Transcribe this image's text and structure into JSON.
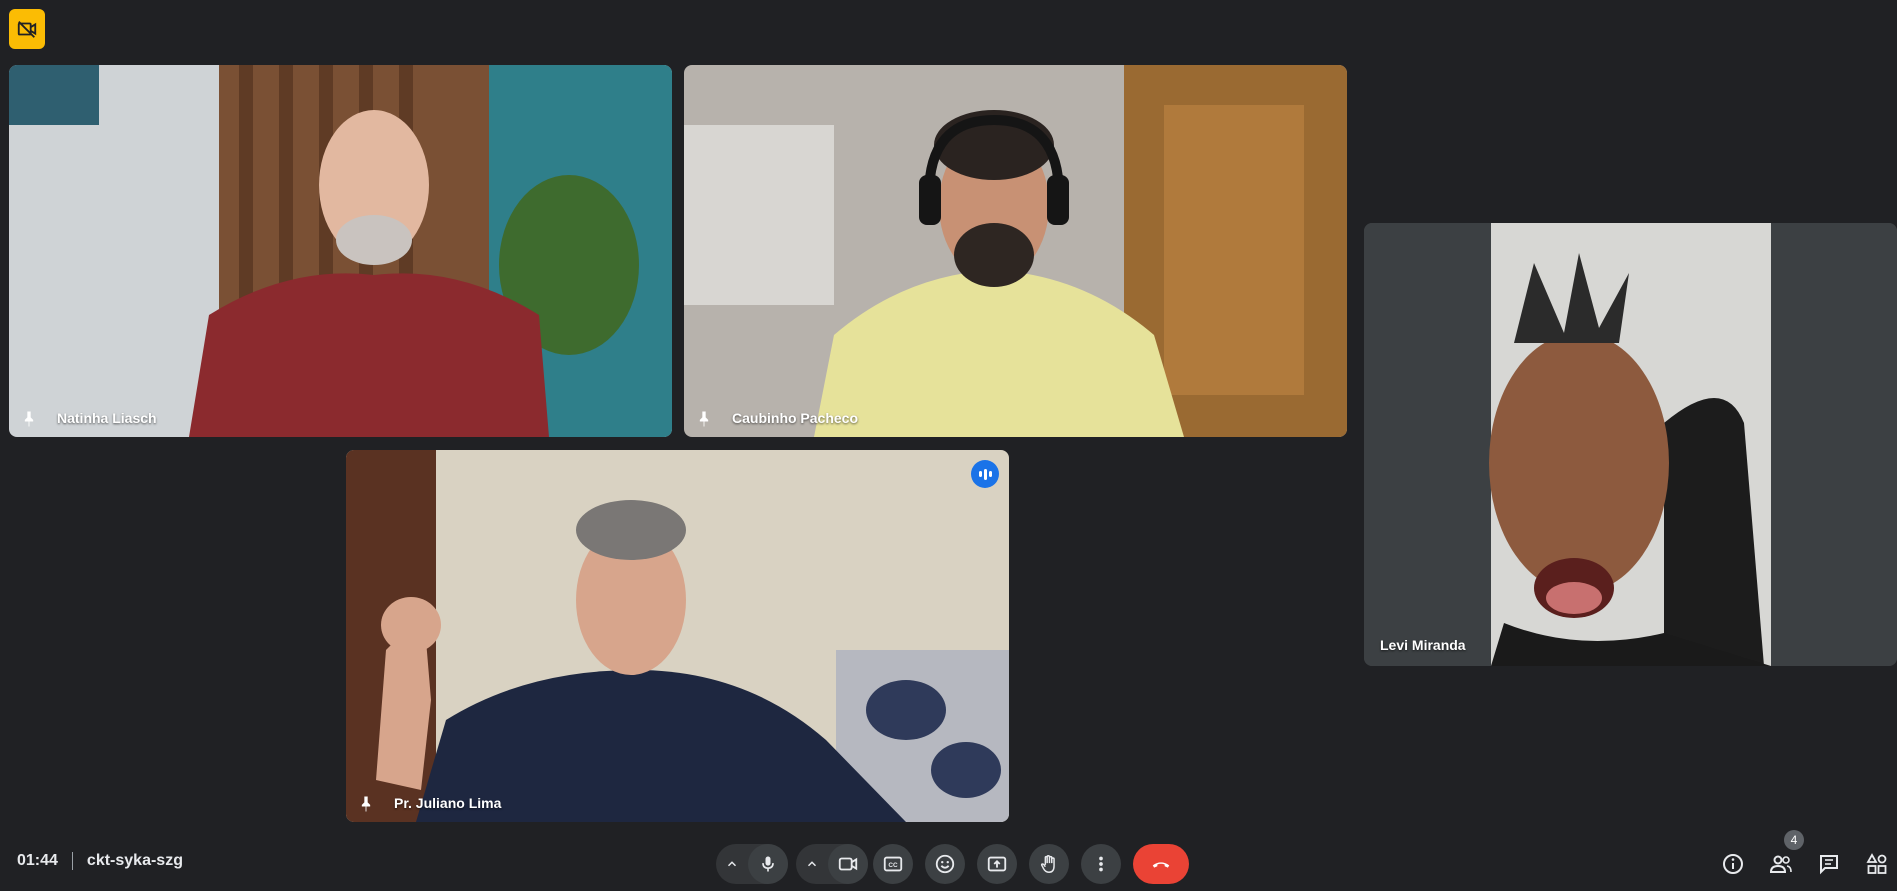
{
  "meeting": {
    "time": "01:44",
    "code": "ckt-syka-szg",
    "participant_count": "4"
  },
  "participants": [
    {
      "name": "Natinha Liasch"
    },
    {
      "name": "Caubinho Pacheco"
    },
    {
      "name": "Levi Miranda"
    },
    {
      "name": "Pr. Juliano Lima"
    }
  ],
  "controls": {
    "mic": "mic-icon",
    "camera": "camera-icon",
    "captions": "captions-icon",
    "reactions": "emoji-icon",
    "present": "present-icon",
    "raise_hand": "hand-icon",
    "more": "more-vert-icon",
    "leave": "end-call-icon"
  },
  "colors": {
    "background": "#202124",
    "control": "#3c4043",
    "leave": "#ea4335",
    "speaking": "#1a73e8",
    "badge": "#fbbc04"
  }
}
